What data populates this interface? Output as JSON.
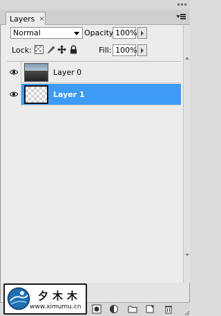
{
  "panel": {
    "tab_label": "Layers",
    "tab_close": "×"
  },
  "controls": {
    "blend_mode": "Normal",
    "opacity_label": "Opacity:",
    "opacity_value": "100%",
    "lock_label": "Lock:",
    "fill_label": "Fill:",
    "fill_value": "100%"
  },
  "layers": [
    {
      "name": "Layer 0",
      "visible": true,
      "selected": false,
      "thumbnail": "photo"
    },
    {
      "name": "Layer 1",
      "visible": true,
      "selected": true,
      "thumbnail": "transparent"
    }
  ],
  "watermark": {
    "title": "夕木木",
    "url": "www.ximumu.cn"
  },
  "colors": {
    "selection": "#3d9bf6"
  }
}
